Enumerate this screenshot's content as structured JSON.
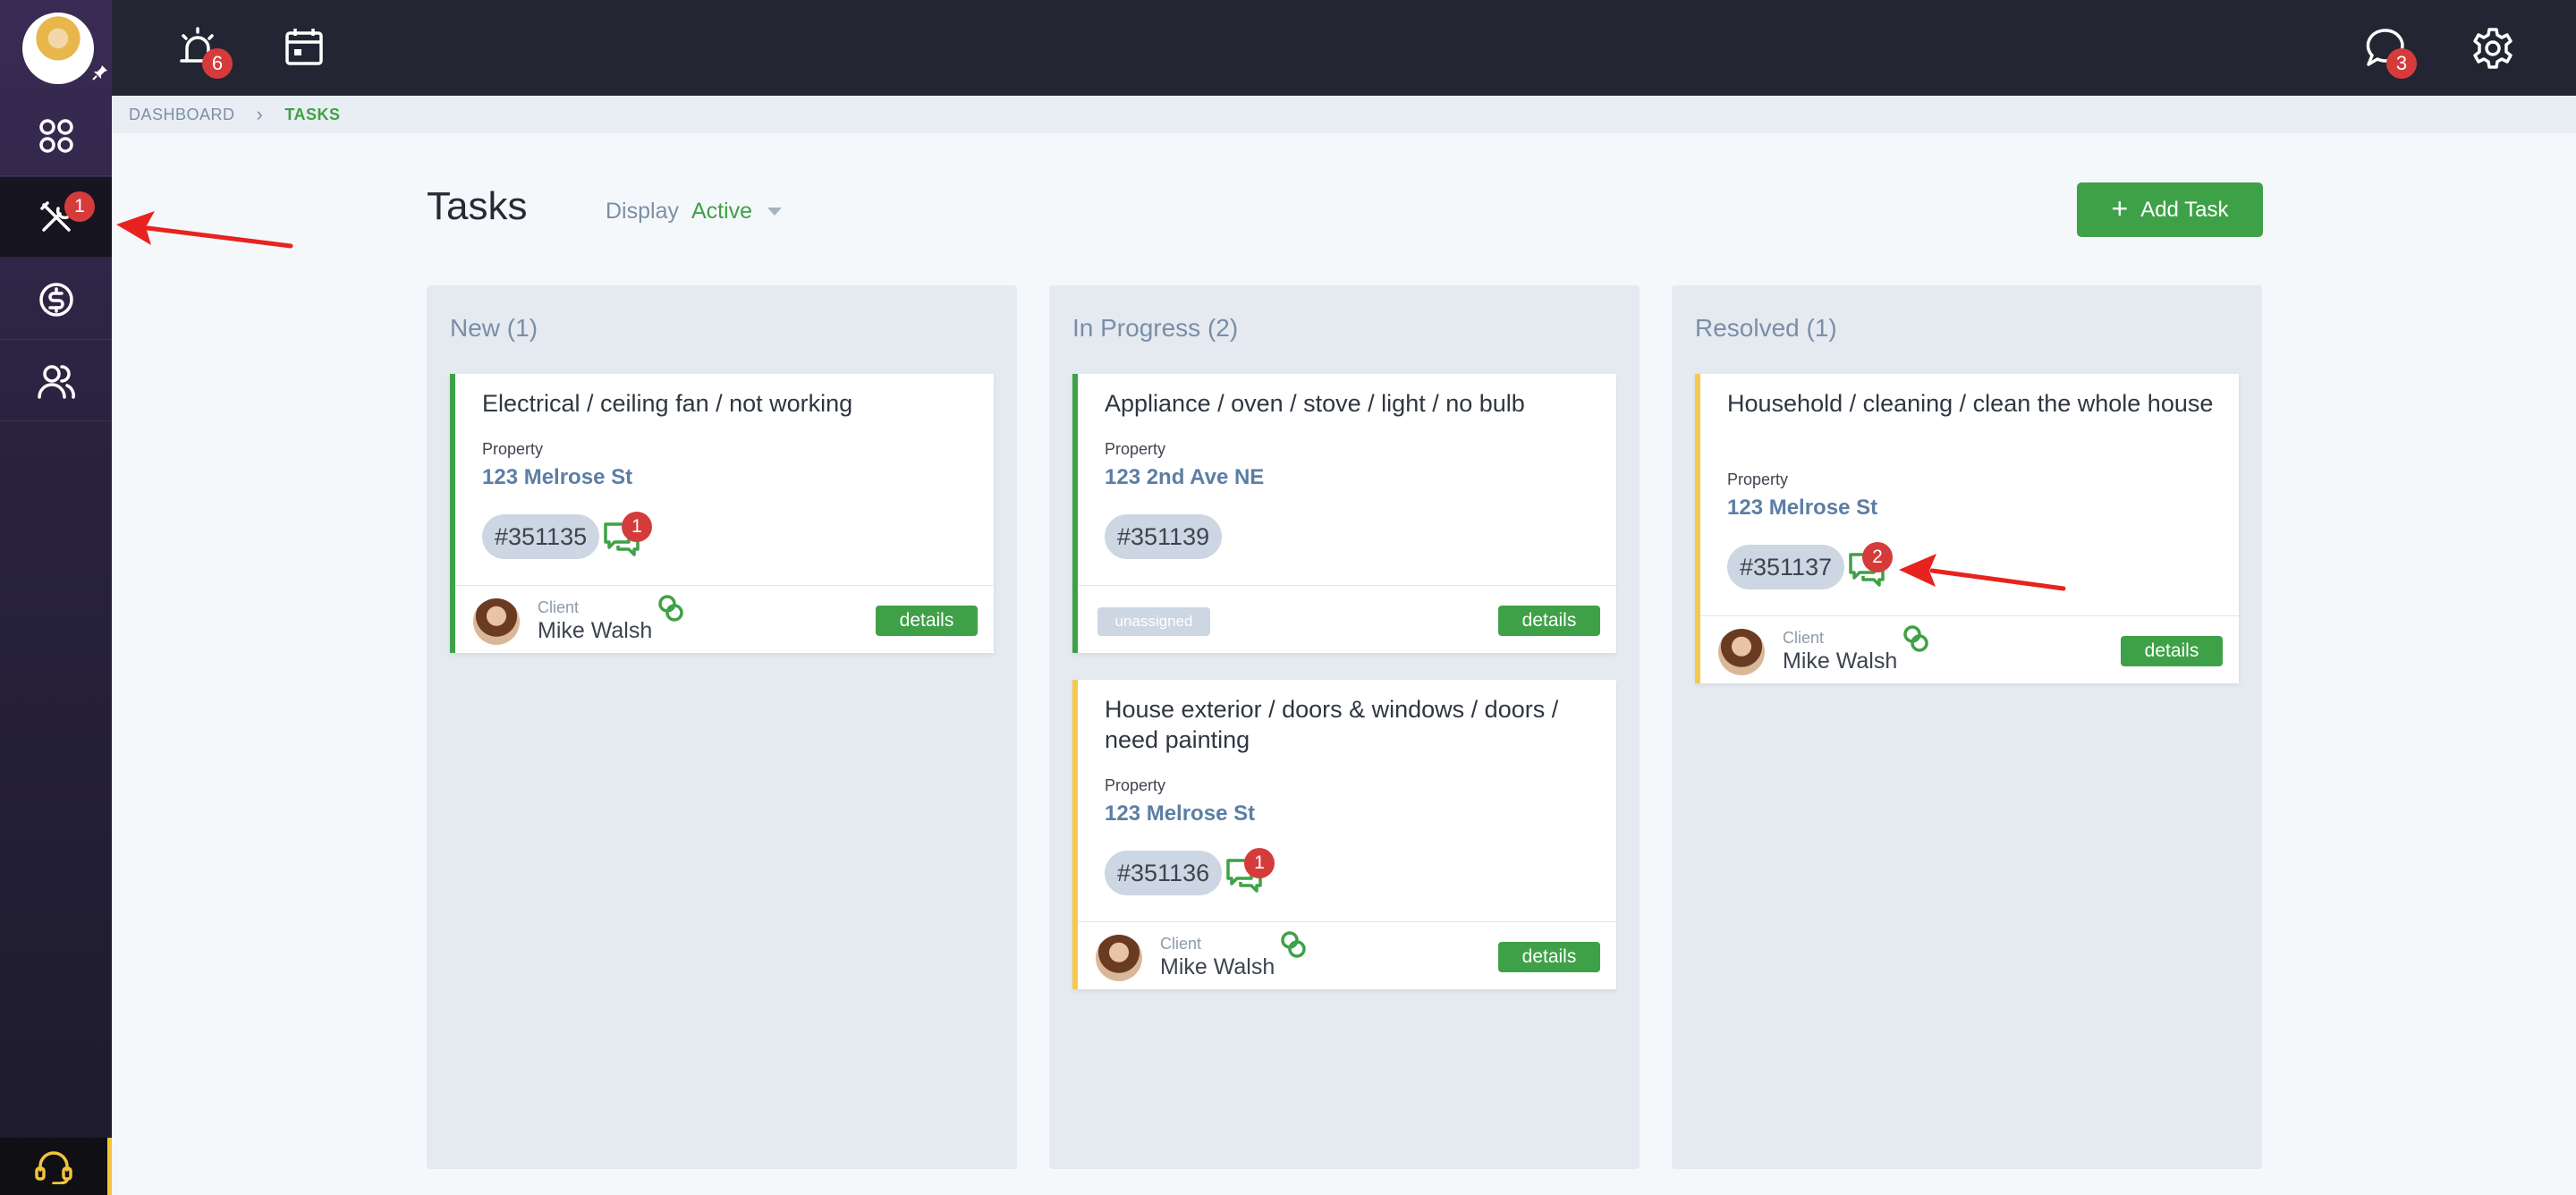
{
  "sidebar": {
    "items": [
      {
        "icon": "dashboard-grid-icon"
      },
      {
        "icon": "tools-icon",
        "badge": "1",
        "active": true
      },
      {
        "icon": "dollar-circle-icon"
      },
      {
        "icon": "users-icon"
      }
    ],
    "support_icon": "headset-icon"
  },
  "topbar": {
    "alarm_badge": "6",
    "chat_badge": "3"
  },
  "breadcrumb": {
    "home": "DASHBOARD",
    "current": "TASKS"
  },
  "header": {
    "title": "Tasks",
    "display_label": "Display",
    "display_value": "Active",
    "add_label": "Add Task"
  },
  "columns": [
    {
      "title": "New (1)",
      "cards": [
        {
          "title": "Electrical / ceiling fan / not working",
          "property_label": "Property",
          "property": "123 Melrose St",
          "ticket": "#351135",
          "messages": "1",
          "client_label": "Client",
          "client": "Mike Walsh",
          "details": "details",
          "accent": "#3fa147"
        }
      ]
    },
    {
      "title": "In Progress (2)",
      "cards": [
        {
          "title": "Appliance / oven / stove / light / no bulb",
          "property_label": "Property",
          "property": "123 2nd Ave NE",
          "ticket": "#351139",
          "assignee": "unassigned",
          "details": "details",
          "accent": "#3fa147"
        },
        {
          "title": "House exterior / doors & windows / doors / need painting",
          "property_label": "Property",
          "property": "123 Melrose St",
          "ticket": "#351136",
          "messages": "1",
          "client_label": "Client",
          "client": "Mike Walsh",
          "details": "details",
          "accent": "#f5c94d"
        }
      ]
    },
    {
      "title": "Resolved (1)",
      "cards": [
        {
          "title": "Household / cleaning / clean the whole house",
          "property_label": "Property",
          "property": "123 Melrose St",
          "ticket": "#351137",
          "messages": "2",
          "client_label": "Client",
          "client": "Mike Walsh",
          "details": "details",
          "accent": "#f5c94d"
        }
      ]
    }
  ],
  "colors": {
    "accent_green": "#3fa147",
    "badge_red": "#d63b3b",
    "annotation_red": "#e8231f"
  }
}
